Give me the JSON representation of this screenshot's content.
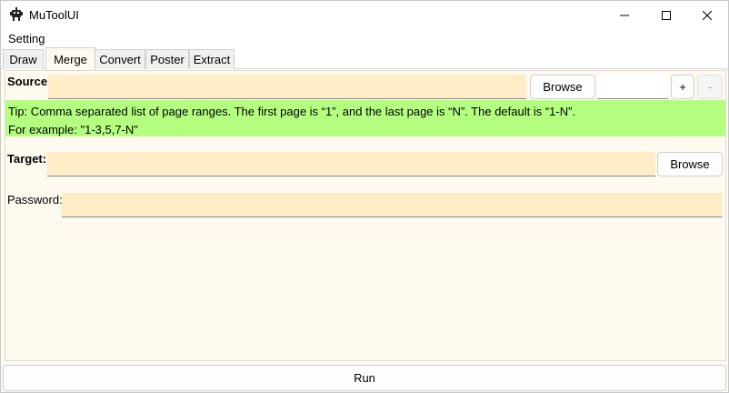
{
  "window": {
    "title": "MuToolUI"
  },
  "menu": {
    "setting": "Setting"
  },
  "tabs": [
    {
      "label": "Draw",
      "active": false
    },
    {
      "label": "Merge",
      "active": true
    },
    {
      "label": "Convert",
      "active": false
    },
    {
      "label": "Poster",
      "active": false
    },
    {
      "label": "Extract",
      "active": false
    }
  ],
  "merge": {
    "source_label": "Source:",
    "source_value": "",
    "source_browse": "Browse",
    "page_range_value": "",
    "add_button": "+",
    "remove_button": "-",
    "tip_line1": "Tip: Comma separated list of page ranges. The first page is “1”, and the last page is “N”. The default is “1-N”.",
    "tip_line2": "For example: \"1-3,5,7-N\"",
    "target_label": "Target:",
    "target_value": "",
    "target_browse": "Browse",
    "password_label": "Password:",
    "password_value": ""
  },
  "run_button": "Run",
  "colors": {
    "input_bg": "#ffedc8",
    "tip_bg": "#b4ff80",
    "content_bg": "#fffaf0"
  },
  "icons": {
    "app": "robot-icon",
    "minimize": "minimize-icon",
    "maximize": "maximize-icon",
    "close": "close-icon"
  }
}
